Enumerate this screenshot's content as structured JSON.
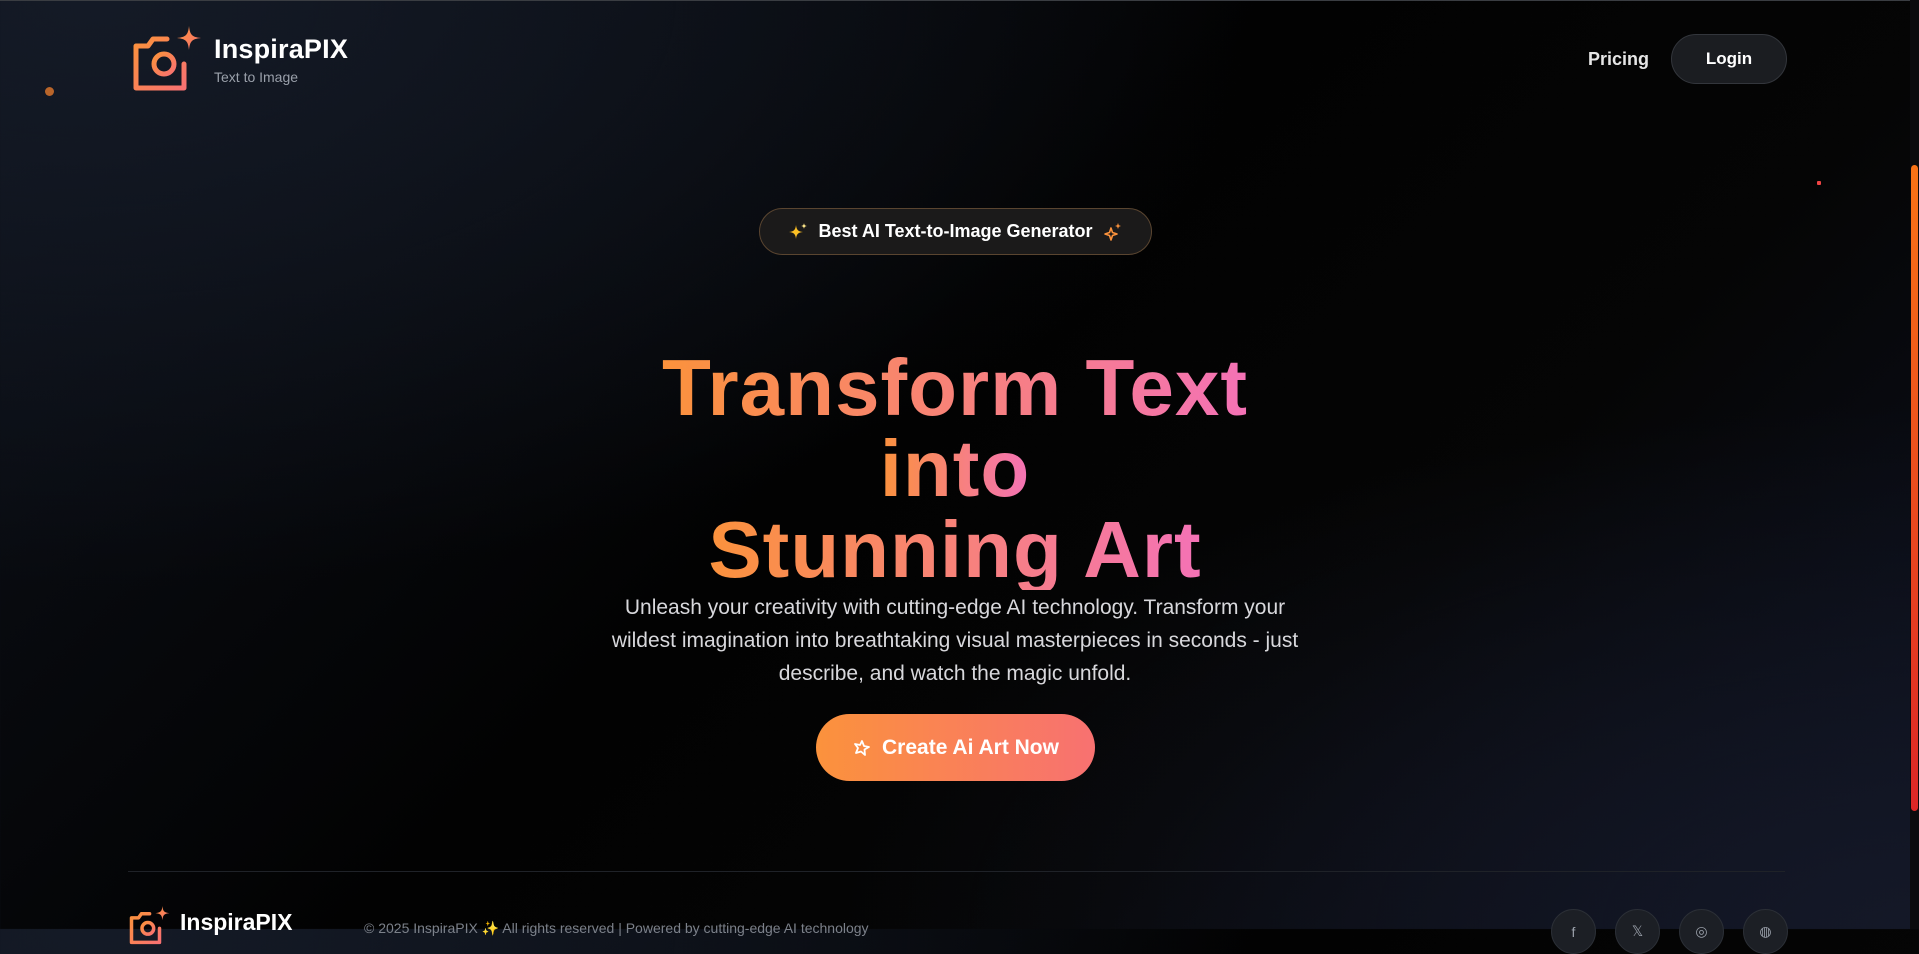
{
  "header": {
    "brand_name": "InspiraPIX",
    "tagline": "Text to Image",
    "nav": {
      "pricing": "Pricing",
      "login": "Login"
    }
  },
  "hero": {
    "badge": "Best AI Text-to-Image Generator",
    "title_line1": "Transform Text",
    "title_line2": "into",
    "title_line3": "Stunning Art",
    "description": "Unleash your creativity with cutting-edge AI technology. Transform your wildest imagination into breathtaking visual masterpieces in seconds - just describe, and watch the magic unfold.",
    "cta": "Create Ai Art Now"
  },
  "footer": {
    "brand_name": "InspiraPIX",
    "copyright": "© 2025 InspiraPIX ✨ All rights reserved | Powered by cutting-edge AI technology",
    "social_icons": [
      "facebook-icon",
      "twitter-icon",
      "instagram-icon",
      "discord-icon"
    ]
  },
  "colors": {
    "accent_orange": "#fb923c",
    "accent_pink": "#f472b6",
    "background": "#050505"
  }
}
